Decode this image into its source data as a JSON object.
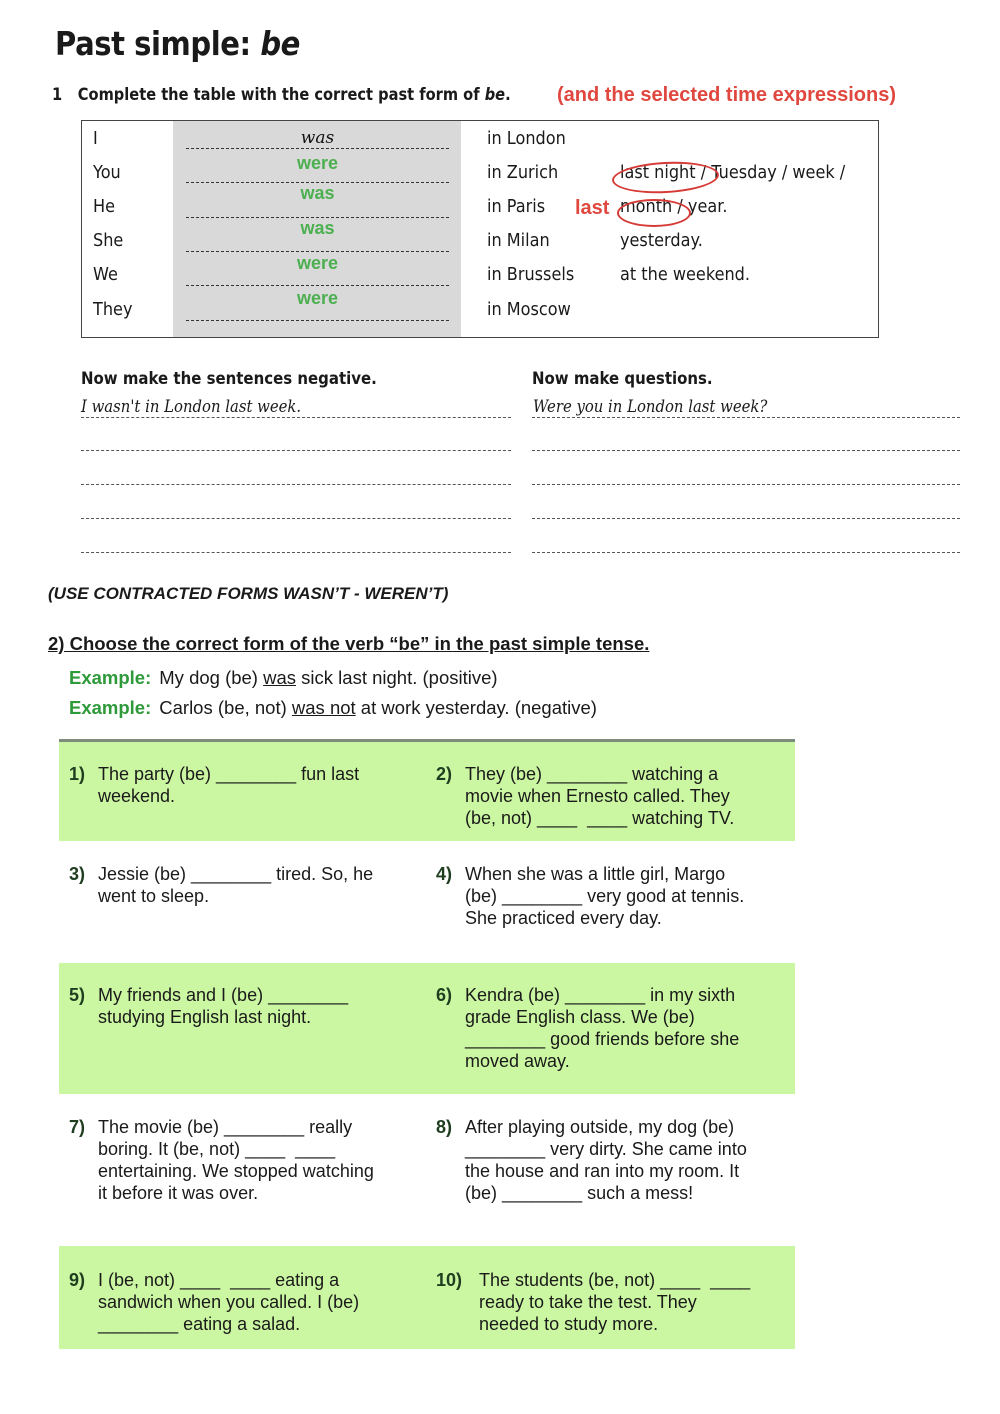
{
  "title": {
    "main": "Past simple: ",
    "italic": "be"
  },
  "exercise1": {
    "number": "1",
    "instruction_main": "Complete the table with the correct past form of ",
    "instruction_italic": "be",
    "instruction_end": ".",
    "instruction_added": "(and the selected time expressions)",
    "rows": [
      {
        "subject": "I",
        "answer": "was",
        "place": "in London"
      },
      {
        "subject": "You",
        "answer": "were",
        "place": "in Zurich"
      },
      {
        "subject": "He",
        "answer": "was",
        "place": "in Paris"
      },
      {
        "subject": "She",
        "answer": "was",
        "place": "in Milan"
      },
      {
        "subject": "We",
        "answer": "were",
        "place": "in Brussels"
      },
      {
        "subject": "They",
        "answer": "were",
        "place": "in Moscow"
      }
    ],
    "time_expressions": [
      "last night / Tuesday / week /",
      "month / year.",
      "yesterday.",
      "at the weekend."
    ],
    "time_added_word": "last",
    "circled": [
      "last night",
      "month"
    ],
    "colors": {
      "answer_green": "#4caf50",
      "annotation_red": "#e0473f",
      "table_shade": "#d9d9d9"
    }
  },
  "negatives": {
    "heading": "Now make the sentences negative.",
    "example": "I wasn't in London last week.",
    "blank_lines": 4
  },
  "questions": {
    "heading": "Now make questions.",
    "example": "Were you in London last week?",
    "blank_lines": 4
  },
  "note": "(USE CONTRACTED FORMS WASN’T - WEREN’T)",
  "exercise2": {
    "heading": "2) Choose the correct form of the verb “be” in the past simple tense.",
    "examples": [
      {
        "label": "Example:",
        "before": "My dog (be) ",
        "underlined": "was",
        "after": " sick last night. (positive)"
      },
      {
        "label": "Example:",
        "before": "Carlos (be, not) ",
        "underlined": "was not",
        "after": " at work yesterday. (negative)"
      }
    ],
    "colors": {
      "band_green": "#ccf7a2",
      "example_label": "#2e9a3a"
    },
    "questions": [
      {
        "num": "1)",
        "lines": [
          "The party (be) ________ fun last",
          "weekend."
        ]
      },
      {
        "num": "2)",
        "lines": [
          "They (be) ________ watching a",
          "movie when Ernesto called. They",
          "(be, not) ____  ____ watching TV."
        ]
      },
      {
        "num": "3)",
        "lines": [
          "Jessie (be) ________ tired. So, he",
          "went to sleep."
        ]
      },
      {
        "num": "4)",
        "lines": [
          "When she was a little girl, Margo",
          "(be) ________ very good at tennis.",
          "She practiced every day."
        ]
      },
      {
        "num": "5)",
        "lines": [
          "My friends and I (be) ________",
          "studying English last night."
        ]
      },
      {
        "num": "6)",
        "lines": [
          "Kendra (be) ________ in my sixth",
          "grade English class. We (be)",
          "________ good friends before she",
          "moved away."
        ]
      },
      {
        "num": "7)",
        "lines": [
          "The movie (be) ________ really",
          "boring. It (be, not) ____  ____",
          "entertaining. We stopped watching",
          "it before it was over."
        ]
      },
      {
        "num": "8)",
        "lines": [
          "After playing outside, my dog (be)",
          "________ very dirty. She came into",
          "the house and ran into my room. It",
          "(be) ________ such a mess!"
        ]
      },
      {
        "num": "9)",
        "lines": [
          "I (be, not) ____  ____ eating a",
          "sandwich when you called. I (be)",
          "________ eating a salad."
        ]
      },
      {
        "num": "10)",
        "lines": [
          "The students (be, not) ____  ____",
          "ready to take the test. They",
          "needed to study more."
        ]
      }
    ]
  }
}
